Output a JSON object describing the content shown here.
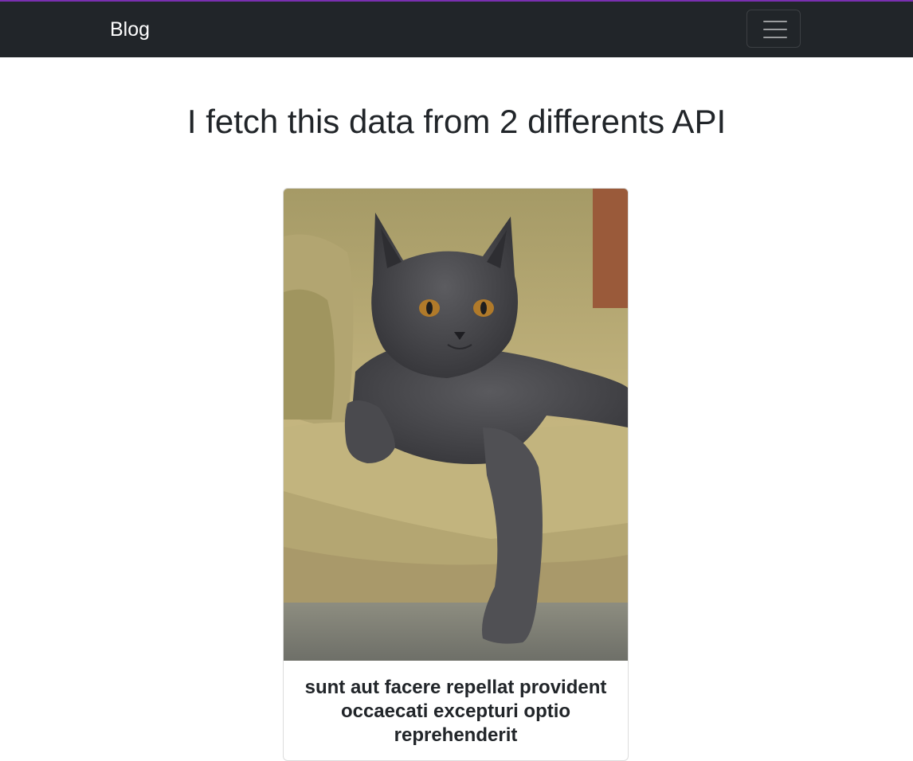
{
  "navbar": {
    "brand": "Blog",
    "toggler_icon": "hamburger-menu-icon"
  },
  "main": {
    "heading": "I fetch this data from 2 differents API"
  },
  "cards": [
    {
      "image": "cat-photo",
      "title": "sunt aut facere repellat provident occaecati excepturi optio reprehenderit"
    }
  ],
  "colors": {
    "navbar_bg": "#212529",
    "accent_strip": "#7a2fb0",
    "page_bg": "#ffffff",
    "text": "#212529"
  }
}
